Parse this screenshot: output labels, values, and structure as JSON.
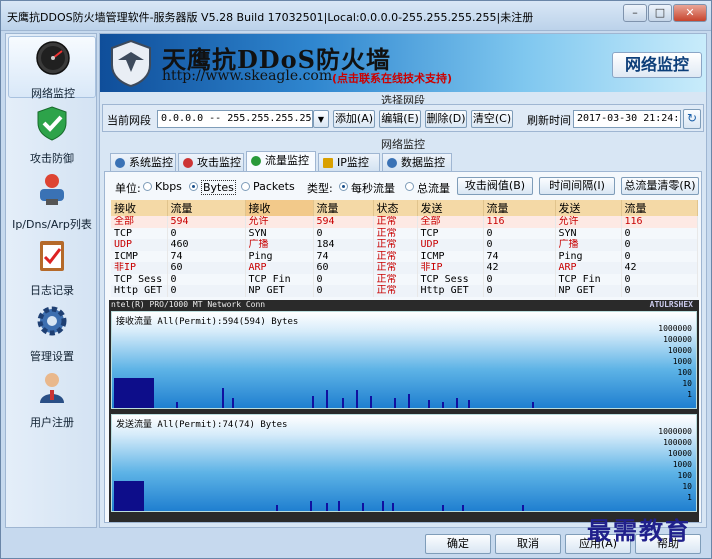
{
  "window": {
    "title": "天鹰抗DDOS防火墙管理软件-服务器版 V5.28 Build 17032501|Local:0.0.0.0-255.255.255.255|未注册"
  },
  "sidebar": {
    "items": [
      {
        "label": "网络监控"
      },
      {
        "label": "攻击防御"
      },
      {
        "label": "Ip/Dns/Arp列表"
      },
      {
        "label": "日志记录"
      },
      {
        "label": "管理设置"
      },
      {
        "label": "用户注册"
      }
    ]
  },
  "banner": {
    "title": "天鹰抗DDoS防火墙",
    "url": "http://www.skeagle.com",
    "note": "(点击联系在线技术支持)",
    "section": "网络监控"
  },
  "segment": {
    "group_title": "选择网段",
    "label": "当前网段",
    "value": "0.0.0.0 -- 255.255.255.255",
    "add": "添加(A)",
    "edit": "编辑(E)",
    "delete": "删除(D)",
    "clear": "清空(C)",
    "refresh_label": "刷新时间",
    "refresh_value": "2017-03-30 21:24:14"
  },
  "monitor": {
    "group_title": "网络监控",
    "tabs": [
      {
        "label": "系统监控",
        "color": "#3a72b5"
      },
      {
        "label": "攻击监控",
        "color": "#c33"
      },
      {
        "label": "流量监控",
        "color": "#2a9a3a"
      },
      {
        "label": "IP监控",
        "color": "#d9a000"
      },
      {
        "label": "数据监控",
        "color": "#3a72b5"
      }
    ],
    "unit_label": "单位:",
    "unit_options": [
      "Kbps",
      "Bytes",
      "Packets"
    ],
    "type_label": "类型:",
    "type_options": [
      "每秒流量",
      "总流量"
    ],
    "btn_threshold": "攻击阀值(B)",
    "btn_interval": "时间间隔(I)",
    "btn_reset": "总流量清零(R)"
  },
  "table": {
    "headers": [
      "接收",
      "流量",
      "接收",
      "流量",
      "状态",
      "发送",
      "流量",
      "发送",
      "流量"
    ],
    "rows": [
      [
        "全部",
        "594",
        "允许",
        "594",
        "正常",
        "全部",
        "116",
        "允许",
        "116"
      ],
      [
        "TCP",
        "0",
        "SYN",
        "0",
        "正常",
        "TCP",
        "0",
        "SYN",
        "0"
      ],
      [
        "UDP",
        "460",
        "广播",
        "184",
        "正常",
        "UDP",
        "0",
        "广播",
        "0"
      ],
      [
        "ICMP",
        "74",
        "Ping",
        "74",
        "正常",
        "ICMP",
        "74",
        "Ping",
        "0"
      ],
      [
        "非IP",
        "60",
        "ARP",
        "60",
        "正常",
        "非IP",
        "42",
        "ARP",
        "42"
      ],
      [
        "TCP Sess",
        "0",
        "TCP Fin",
        "0",
        "正常",
        "TCP Sess",
        "0",
        "TCP Fin",
        "0"
      ],
      [
        "Http GET",
        "0",
        "NP GET",
        "0",
        "正常",
        "Http GET",
        "0",
        "NP GET",
        "0"
      ]
    ]
  },
  "graphs": {
    "nic": "ntel(R) PRO/1000 MT Network Conn",
    "brand": "ATULRSHEX",
    "recv_title": "接收流量  All(Permit):594(594) Bytes",
    "send_title": "发送流量  All(Permit):74(74) Bytes",
    "scale": [
      "1000000",
      "100000",
      "10000",
      "1000",
      "100",
      "10",
      "1"
    ]
  },
  "footer": {
    "ok": "确定",
    "cancel": "取消",
    "apply": "应用(A)",
    "help": "帮助",
    "watermark": "最需教育"
  }
}
